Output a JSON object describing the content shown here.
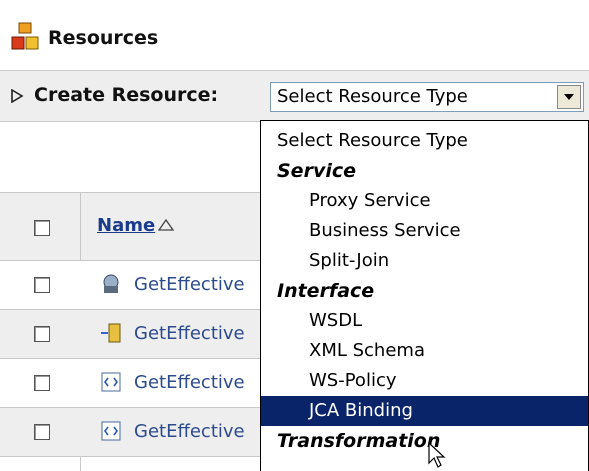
{
  "header": {
    "title": "Resources",
    "icon": "resources-icon"
  },
  "create": {
    "label": "Create Resource:",
    "select_value": "Select Resource Type"
  },
  "table": {
    "name_header": "Name",
    "rows": [
      {
        "label": "GetEffective",
        "icon": "proxy-service-icon"
      },
      {
        "label": "GetEffective",
        "icon": "split-join-icon"
      },
      {
        "label": "GetEffective",
        "icon": "wsdl-icon"
      },
      {
        "label": "GetEffective",
        "icon": "wsdl-icon"
      }
    ]
  },
  "dropdown": {
    "items": [
      {
        "label": "Select Resource Type",
        "kind": "option-top"
      },
      {
        "label": "Service",
        "kind": "group"
      },
      {
        "label": "Proxy Service",
        "kind": "option"
      },
      {
        "label": "Business Service",
        "kind": "option"
      },
      {
        "label": "Split-Join",
        "kind": "option"
      },
      {
        "label": "Interface",
        "kind": "group"
      },
      {
        "label": "WSDL",
        "kind": "option"
      },
      {
        "label": "XML Schema",
        "kind": "option"
      },
      {
        "label": "WS-Policy",
        "kind": "option"
      },
      {
        "label": "JCA Binding",
        "kind": "option",
        "selected": true
      },
      {
        "label": "Transformation",
        "kind": "group"
      }
    ]
  },
  "colors": {
    "selected_bg": "#0a246a",
    "link": "#2c4a8e",
    "header_bg": "#eeeeee"
  }
}
